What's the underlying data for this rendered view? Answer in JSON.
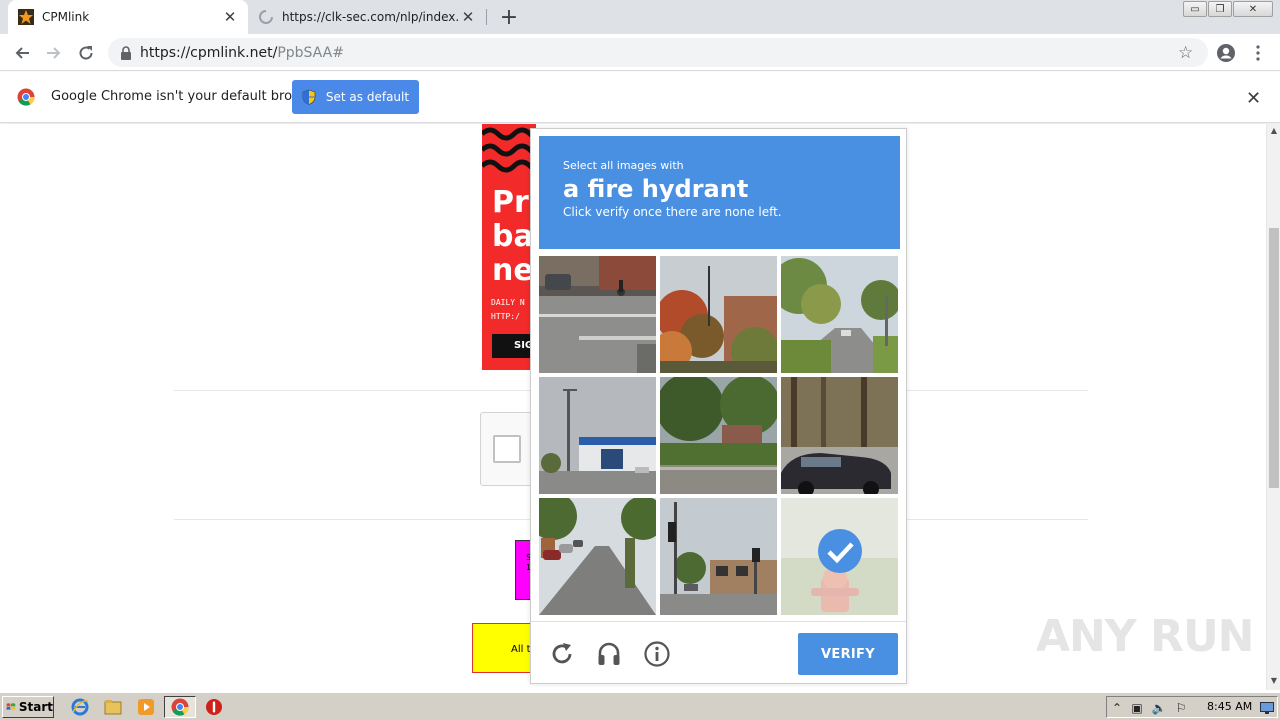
{
  "browser": {
    "tabs": [
      {
        "title": "CPMlink",
        "active": true
      },
      {
        "title": "https://clk-sec.com/nlp/index.php?a",
        "active": false
      }
    ],
    "address_bar": {
      "host": "https://cpmlink.net/",
      "path": "PpbSAA#"
    },
    "infobar": {
      "message": "Google Chrome isn't your default browser",
      "button_label": "Set as default"
    }
  },
  "page": {
    "ad_banner": {
      "headline": "Pro\nba\nne",
      "small_text": "DAILY N\nHTTP:/",
      "button_label": "SIG"
    },
    "magenta_box_text": "S\n10",
    "yellow_box_text": "All t",
    "watermark": "ANY RUN"
  },
  "captcha": {
    "instruction_small": "Select all images with",
    "target_object": "a fire hydrant",
    "hint": "Click verify once there are none left.",
    "verify_label": "VERIFY",
    "tiles": [
      {
        "scene": "street-corner-cyclist",
        "selected": false
      },
      {
        "scene": "autumn-trees-building",
        "selected": false
      },
      {
        "scene": "tree-lined-road",
        "selected": false
      },
      {
        "scene": "office-building-lot",
        "selected": false
      },
      {
        "scene": "suburban-lawn-house",
        "selected": false
      },
      {
        "scene": "parked-car-woods",
        "selected": false
      },
      {
        "scene": "residential-street-cars",
        "selected": false
      },
      {
        "scene": "traffic-light-intersection",
        "selected": false
      },
      {
        "scene": "fire-hydrant",
        "selected": true
      }
    ],
    "footer_icons": [
      "reload-icon",
      "audio-icon",
      "info-icon"
    ]
  },
  "taskbar": {
    "start_label": "Start",
    "clock": "8:45 AM"
  },
  "colors": {
    "captcha_blue": "#4a90e2",
    "infobar_button": "#4a89e8",
    "ad_red": "#f22a2a",
    "magenta": "#ff00ff",
    "yellow": "#ffff00"
  }
}
